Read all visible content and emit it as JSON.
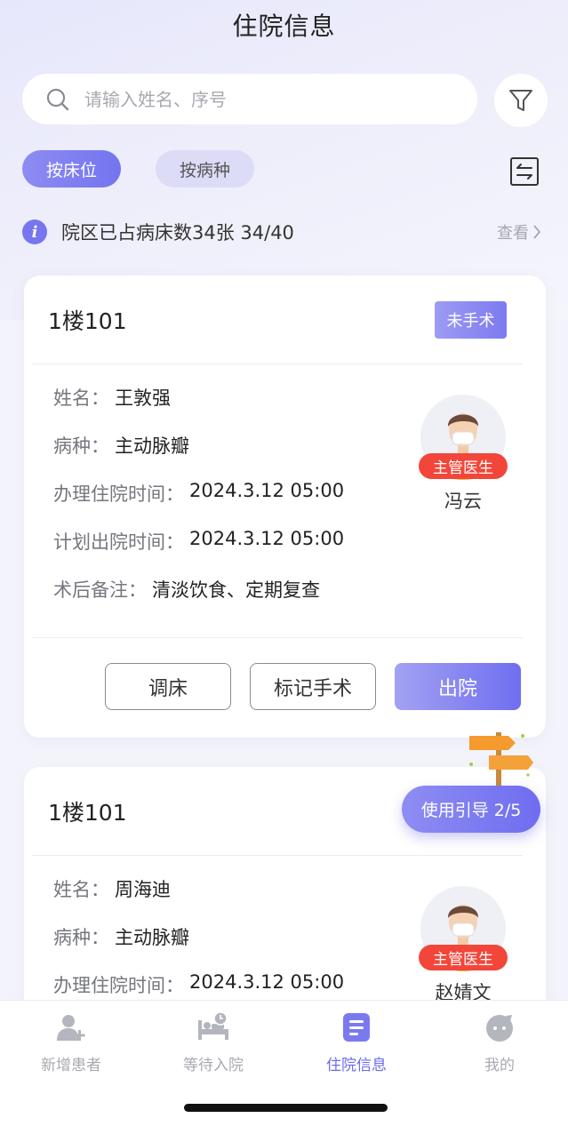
{
  "header": {
    "title": "住院信息"
  },
  "search": {
    "placeholder": "请输入姓名、序号",
    "value": ""
  },
  "filters": {
    "chips": [
      {
        "label": "按床位",
        "active": true
      },
      {
        "label": "按病种",
        "active": false
      }
    ]
  },
  "summary": {
    "text": "院区已占病床数34张 34/40",
    "view_label": "查看"
  },
  "cards": [
    {
      "room": "1楼101",
      "status": "未手术",
      "fields": [
        {
          "label": "姓名：",
          "value": "王敦强"
        },
        {
          "label": "病种：",
          "value": "主动脉瓣"
        },
        {
          "label": "办理住院时间：",
          "value": "2024.3.12 05:00"
        },
        {
          "label": "计划出院时间：",
          "value": "2024.3.12 05:00"
        },
        {
          "label": "术后备注：",
          "value": "清淡饮食、定期复查"
        }
      ],
      "doctor": {
        "badge": "主管医生",
        "name": "冯云"
      },
      "actions": {
        "adjust_bed": "调床",
        "mark_surgery": "标记手术",
        "discharge": "出院"
      }
    },
    {
      "room": "1楼101",
      "fields": [
        {
          "label": "姓名：",
          "value": "周海迪"
        },
        {
          "label": "病种：",
          "value": "主动脉瓣"
        },
        {
          "label": "办理住院时间：",
          "value": "2024.3.12 05:00"
        }
      ],
      "doctor": {
        "badge": "主管医生",
        "name": "赵婧文"
      }
    }
  ],
  "guide": {
    "label": "使用引导 2/5"
  },
  "tabbar": {
    "items": [
      {
        "label": "新增患者",
        "icon": "add-user-icon",
        "active": false
      },
      {
        "label": "等待入院",
        "icon": "bed-clock-icon",
        "active": false
      },
      {
        "label": "住院信息",
        "icon": "document-icon",
        "active": true
      },
      {
        "label": "我的",
        "icon": "profile-icon",
        "active": false
      }
    ]
  },
  "colors": {
    "accent": "#7474ef",
    "badge_red": "#f2463a",
    "muted": "#a8aab0"
  }
}
